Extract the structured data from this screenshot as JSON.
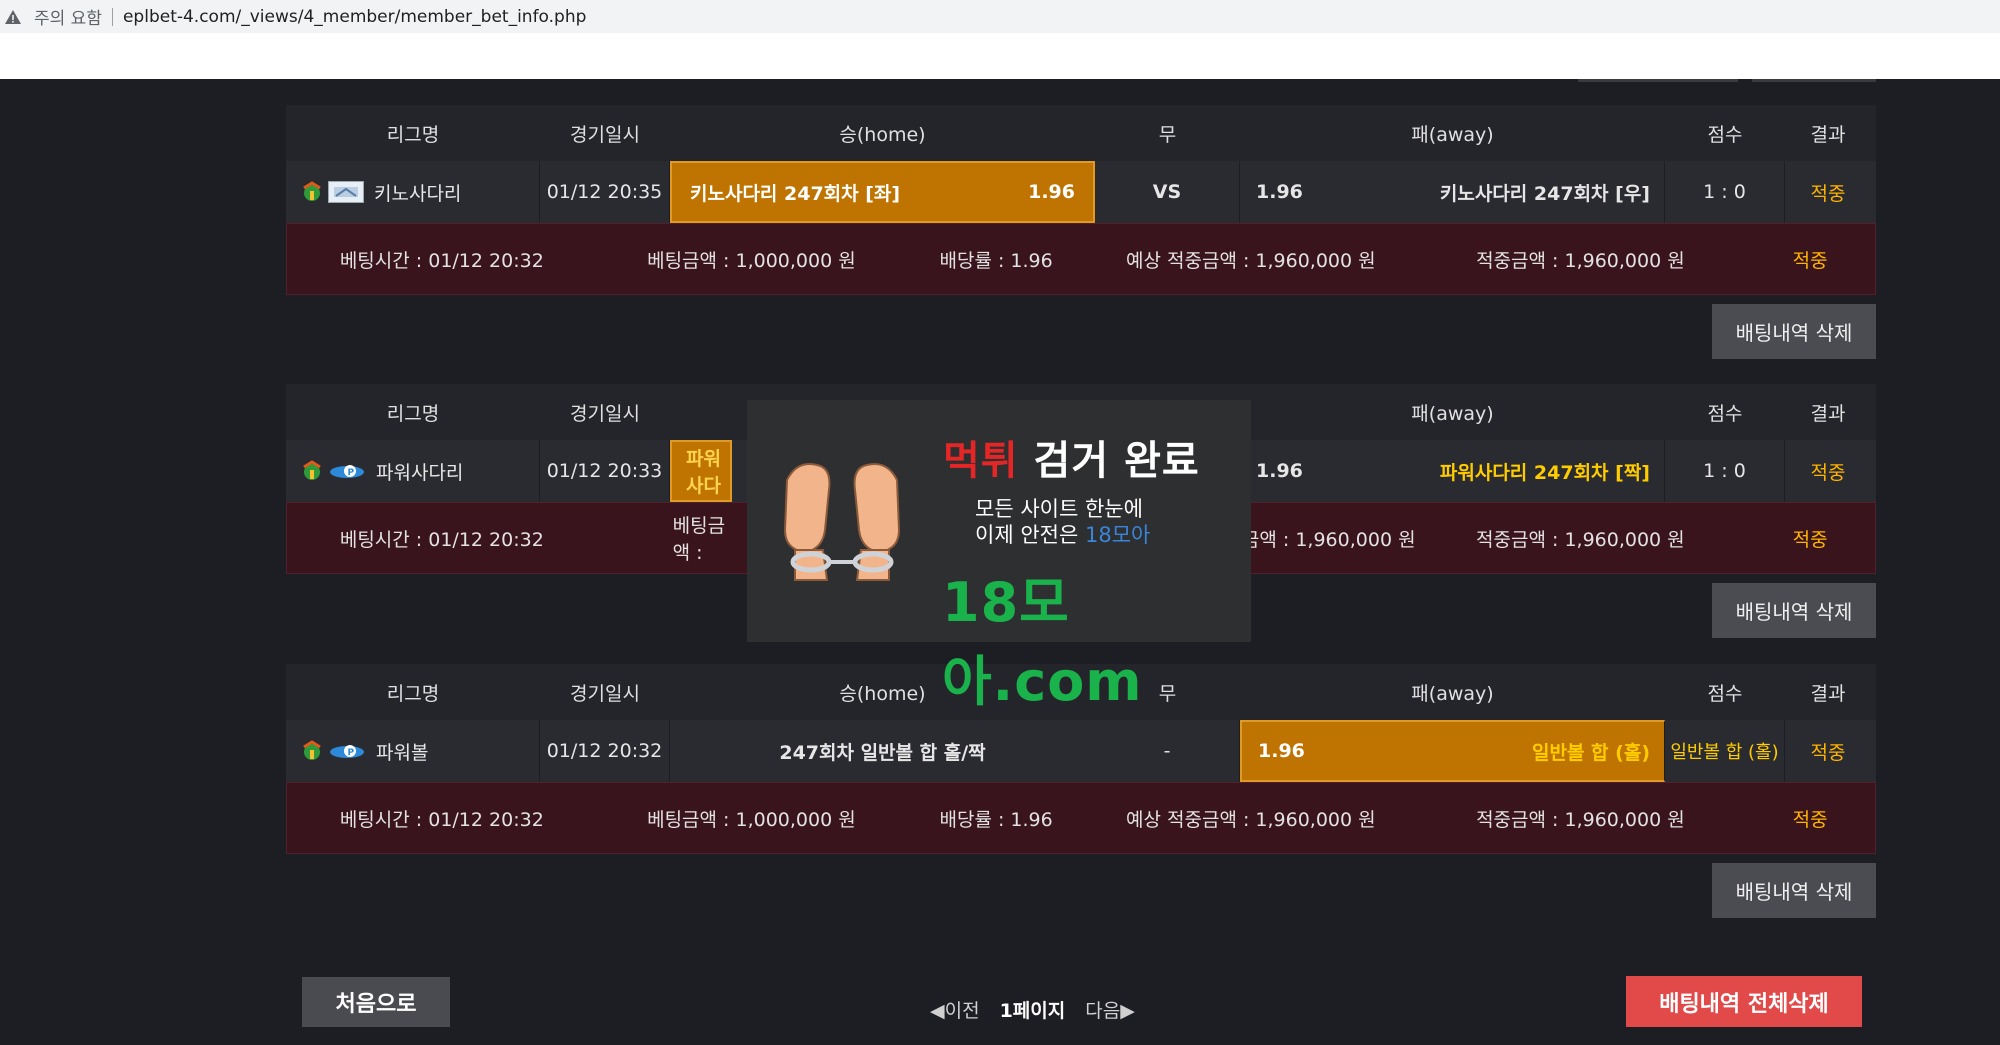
{
  "browser": {
    "warning": "주의 요함",
    "url": "eplbet-4.com/_views/4_member/member_bet_info.php"
  },
  "headers": {
    "league": "리그명",
    "datetime": "경기일시",
    "home": "승(home)",
    "draw": "무",
    "away": "패(away)",
    "score": "점수",
    "result": "결과"
  },
  "bets": [
    {
      "league": "키노사다리",
      "datetime": "01/12 20:35",
      "home_name": "키노사다리 247회차 [좌]",
      "home_odds": "1.96",
      "draw": "VS",
      "away_odds": "1.96",
      "away_name": "키노사다리 247회차 [우]",
      "score": "1 : 0",
      "result": "적중",
      "info": {
        "bet_time": "베팅시간 : 01/12 20:32",
        "amount": "베팅금액 : 1,000,000 원",
        "odds": "배당률 : 1.96",
        "expected": "예상 적중금액 : 1,960,000 원",
        "won": "적중금액 : 1,960,000 원",
        "status": "적중"
      },
      "delete_label": "배팅내역 삭제"
    },
    {
      "league": "파워사다리",
      "datetime": "01/12 20:33",
      "home_name": "파워사다",
      "away_odds": "1.96",
      "away_name": "파워사다리 247회차 [짝]",
      "score": "1 : 0",
      "result": "적중",
      "info": {
        "bet_time": "베팅시간 : 01/12 20:32",
        "amount": "베팅금액 :",
        "expected": "금액 : 1,960,000 원",
        "won": "적중금액 : 1,960,000 원",
        "status": "적중"
      },
      "delete_label": "배팅내역 삭제"
    },
    {
      "league": "파워볼",
      "datetime": "01/12 20:32",
      "home_name": "247회차 일반볼 합 홀/짝",
      "draw": "-",
      "away_odds": "1.96",
      "away_name": "일반볼 합 (홀)",
      "score": "일반볼 합 (홀)",
      "result": "적중",
      "info": {
        "bet_time": "베팅시간 : 01/12 20:32",
        "amount": "베팅금액 : 1,000,000 원",
        "odds": "배당률 : 1.96",
        "expected": "예상 적중금액 : 1,960,000 원",
        "won": "적중금액 : 1,960,000 원",
        "status": "적중"
      },
      "delete_label": "배팅내역 삭제"
    }
  ],
  "footer": {
    "first": "처음으로",
    "prev": "◀이전",
    "page": "1페이지",
    "next": "다음▶",
    "delete_all": "배팅내역 전체삭제"
  },
  "overlay": {
    "title_red": "먹튀",
    "title_white": "검거 완료",
    "line1": "모든 사이트 한눈에",
    "line2_prefix": "이제 안전은",
    "line2_brand": "18모아",
    "domain": "18모아.com"
  }
}
